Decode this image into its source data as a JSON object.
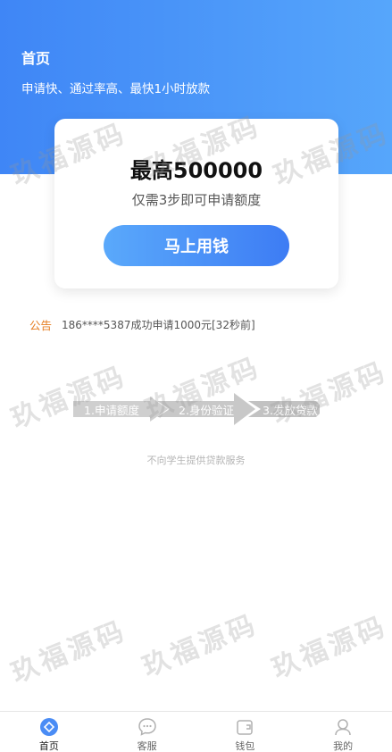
{
  "header": {
    "title": "首页",
    "slogan": "申请快、通过率高、最快1小时放款"
  },
  "card": {
    "max_amount": "最高500000",
    "steps_hint": "仅需3步即可申请额度",
    "button_label": "马上用钱"
  },
  "notice": {
    "tag": "公告",
    "text": "186****5387成功申请1000元[32秒前]"
  },
  "steps": [
    "1.申请额度",
    "2.身份验证",
    "3.发放贷款"
  ],
  "disclaimer": "不向学生提供贷款服务",
  "watermark": "玖福源码",
  "tabbar": {
    "items": [
      {
        "label": "首页",
        "icon": "home-icon",
        "active": true
      },
      {
        "label": "客服",
        "icon": "chat-icon",
        "active": false
      },
      {
        "label": "钱包",
        "icon": "wallet-icon",
        "active": false
      },
      {
        "label": "我的",
        "icon": "user-icon",
        "active": false
      }
    ]
  },
  "colors": {
    "primary": "#3f86f6",
    "primary_light": "#56a6fb",
    "notice_tag": "#e67e22",
    "inactive_icon": "#b0b0b0"
  }
}
